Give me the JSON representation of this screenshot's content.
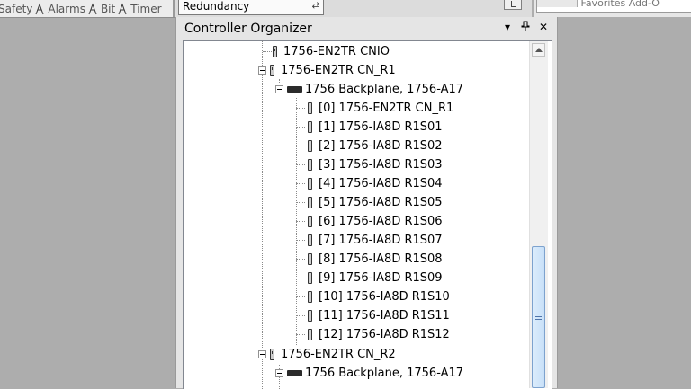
{
  "toolbar": {
    "tabs": [
      "Safety",
      "Alarms",
      "Bit",
      "Timer"
    ],
    "redundancy_label": "Redundancy",
    "favorites_label": "Favorites",
    "add_on_label": "Add-O"
  },
  "panel": {
    "title": "Controller Organizer",
    "buttons": [
      "▾",
      "ᵽ",
      "✕"
    ]
  },
  "tree": {
    "rows": [
      {
        "label": "1756-EN2TR CNIO"
      },
      {
        "label": "1756-EN2TR CN_R1"
      },
      {
        "label": "1756 Backplane, 1756-A17"
      },
      {
        "label": "[0] 1756-EN2TR CN_R1"
      },
      {
        "label": "[1] 1756-IA8D R1S01"
      },
      {
        "label": "[2] 1756-IA8D R1S02"
      },
      {
        "label": "[3] 1756-IA8D R1S03"
      },
      {
        "label": "[4] 1756-IA8D R1S04"
      },
      {
        "label": "[5] 1756-IA8D R1S05"
      },
      {
        "label": "[6] 1756-IA8D R1S06"
      },
      {
        "label": "[7] 1756-IA8D R1S07"
      },
      {
        "label": "[8] 1756-IA8D R1S08"
      },
      {
        "label": "[9] 1756-IA8D R1S09"
      },
      {
        "label": "[10] 1756-IA8D R1S10"
      },
      {
        "label": "[11] 1756-IA8D R1S11"
      },
      {
        "label": "[12] 1756-IA8D R1S12"
      },
      {
        "label": "1756-EN2TR CN_R2"
      },
      {
        "label": "1756 Backplane, 1756-A17"
      }
    ]
  },
  "icons": {
    "module": "module-icon",
    "backplane": "backplane-icon",
    "expander": "collapse-expander-icon"
  }
}
